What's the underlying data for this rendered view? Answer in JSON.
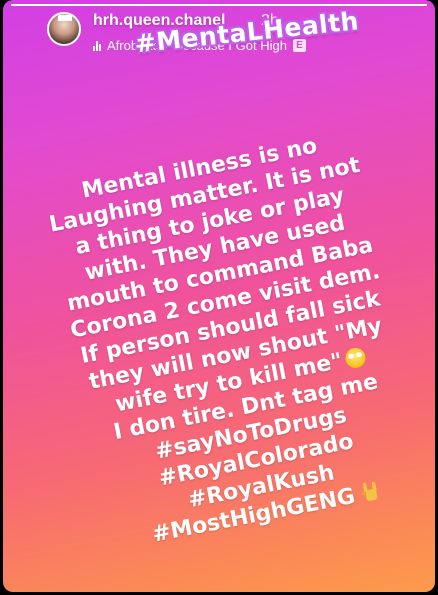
{
  "story": {
    "progress_fraction": 1.0,
    "username": "hrh.queen.chanel",
    "timestamp": "2h",
    "music": {
      "text": "Afrobeats · Because I Got High",
      "icon": "music-bars-icon",
      "explicit_badge": "E"
    },
    "hashtag_sticker": "#MentaLHealth",
    "caption_lines": [
      "Mental illness is no",
      "Laughing matter. It is not",
      "a thing to joke or play",
      "with. They have used",
      "mouth to command Baba",
      "Corona 2 come visit dem.",
      "If person should fall sick",
      "they will now shout \"My",
      "wife try to kill me\"",
      "I don tire. Dnt tag me",
      "#sayNoToDrugs",
      "#RoyalColorado",
      "#RoyalKush",
      "#MostHighGENG"
    ],
    "emojis": {
      "eye_roll": "face-with-rolling-eyes-icon",
      "horns": "sign-of-horns-icon"
    },
    "colors": {
      "gradient_top": "#d23fe4",
      "gradient_mid": "#f0539a",
      "gradient_bottom": "#fd9b4c",
      "sticker_outline": "#c05ee6"
    }
  }
}
